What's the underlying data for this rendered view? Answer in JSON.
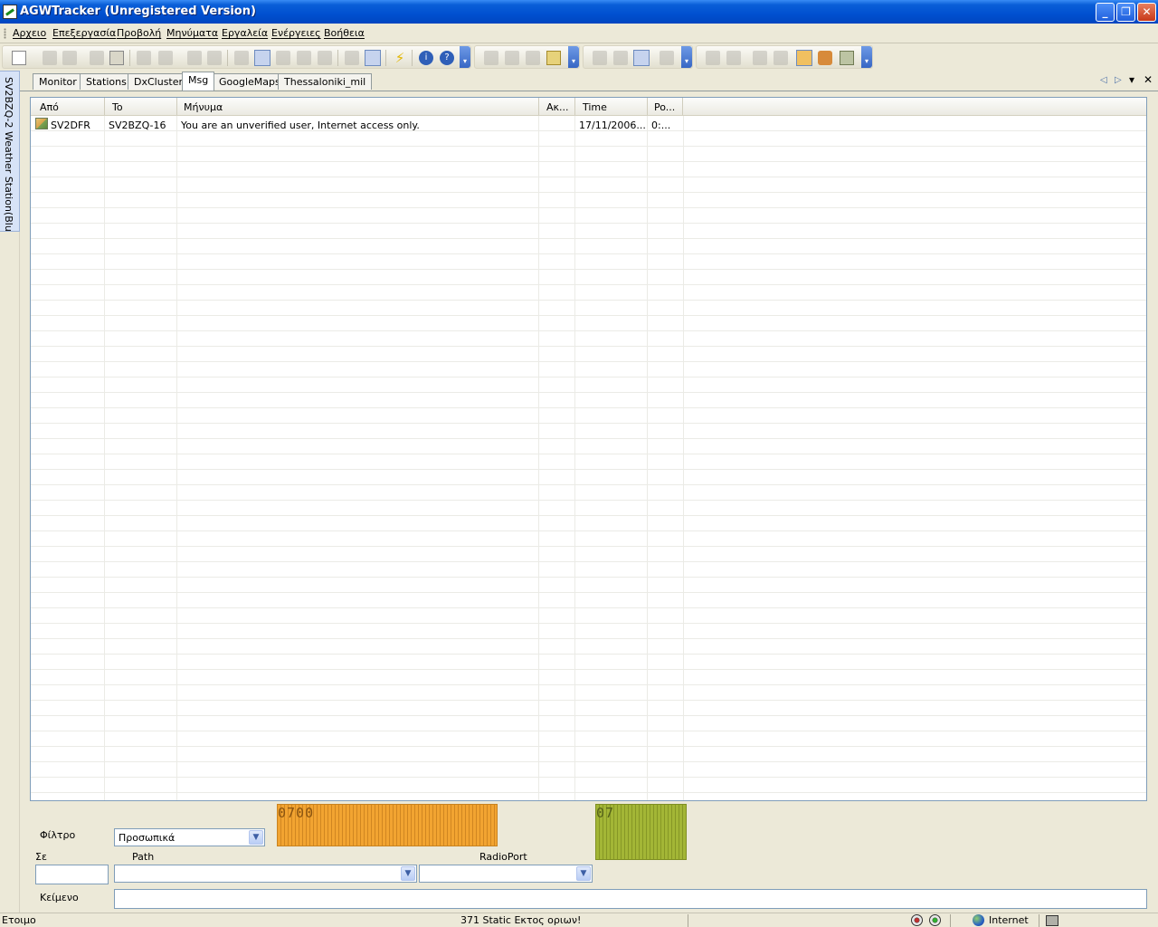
{
  "window": {
    "title": "AGWTracker (Unregistered Version)",
    "controls": {
      "minimize": "_",
      "restore": "❐",
      "close": "✕"
    }
  },
  "menu": [
    "Αρχειο",
    "Επεξεργασία",
    "Προβολή",
    "Μηνύματα",
    "Εργαλεία",
    "Ενέργειες",
    "Βοήθεια"
  ],
  "sidetab": {
    "label": "SV2BZQ-2 Weather Station(Blue)"
  },
  "tabs": [
    {
      "label": "Monitor"
    },
    {
      "label": "Stations"
    },
    {
      "label": "DxCluster"
    },
    {
      "label": "Msg"
    },
    {
      "label": "GoogleMaps"
    },
    {
      "label": "Thessaloniki_mil"
    }
  ],
  "tab_controls": {
    "prev": "◁",
    "next": "▷",
    "menu": "▾",
    "close": "✕"
  },
  "table": {
    "columns": [
      "Από",
      "To",
      "Μήνυμα",
      "Ακ...",
      "Time",
      "Po..."
    ],
    "rows": [
      {
        "from": "SV2DFR",
        "to": "SV2BZQ-16",
        "message": "You are an unverified user, Internet access only.",
        "ack": "",
        "time": "17/11/2006...",
        "port": "0:..."
      }
    ]
  },
  "bottom": {
    "filter_label": "Φίλτρο",
    "filter_value": "Προσωπικά",
    "to_label": "Σε",
    "path_label": "Path",
    "radioport_label": "RadioPort",
    "text_label": "Κείμενο",
    "led1_text": "0700",
    "led2_text": "07"
  },
  "statusbar": {
    "ready": "Ετοιμο",
    "center": "371 Static Εκτος οριων!",
    "internet": "Internet"
  },
  "colors": {
    "led1": "#f2a431",
    "led2": "#a3b636",
    "title_bar": "#0050d0"
  }
}
